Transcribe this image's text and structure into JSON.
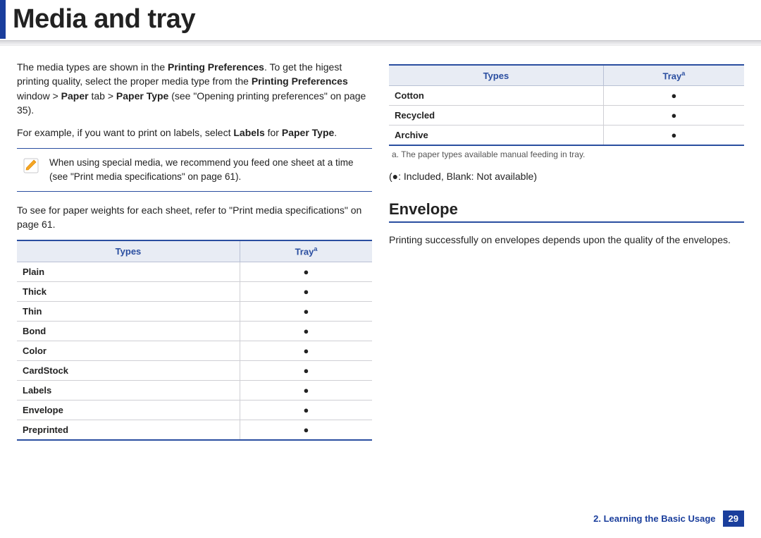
{
  "header": {
    "title": "Media and tray"
  },
  "left": {
    "p1_a": "The media types are shown in the ",
    "p1_b": "Printing Preferences",
    "p1_c": ". To get the higest printing quality, select the proper media type from the ",
    "p1_d": "Printing Preferences",
    "p1_e": " window > ",
    "p1_f": "Paper",
    "p1_g": " tab > ",
    "p1_h": "Paper Type",
    "p1_i": " (see \"Opening printing preferences\" on page 35).",
    "p2_a": "For example, if you want to print on labels, select ",
    "p2_b": "Labels",
    "p2_c": " for ",
    "p2_d": "Paper Type",
    "p2_e": ".",
    "note": "When using special media, we recommend you feed one sheet at a time (see \"Print media specifications\" on page 61).",
    "p3": "To see for paper weights for each sheet, refer to \"Print media specifications\" on page 61.",
    "table": {
      "head_types": "Types",
      "head_tray": "Tray",
      "head_tray_sup": "a",
      "rows": [
        {
          "type": "Plain",
          "mark": "●"
        },
        {
          "type": "Thick",
          "mark": "●"
        },
        {
          "type": "Thin",
          "mark": "●"
        },
        {
          "type": "Bond",
          "mark": "●"
        },
        {
          "type": "Color",
          "mark": "●"
        },
        {
          "type": "CardStock",
          "mark": "●"
        },
        {
          "type": "Labels",
          "mark": "●"
        },
        {
          "type": "Envelope",
          "mark": "●"
        },
        {
          "type": "Preprinted",
          "mark": "●"
        }
      ]
    }
  },
  "right": {
    "table": {
      "head_types": "Types",
      "head_tray": "Tray",
      "head_tray_sup": "a",
      "rows": [
        {
          "type": "Cotton",
          "mark": "●"
        },
        {
          "type": "Recycled",
          "mark": "●"
        },
        {
          "type": "Archive",
          "mark": "●"
        }
      ]
    },
    "footnote": "a. The paper types available manual feeding in tray.",
    "legend": "(●: Included, Blank: Not available)",
    "section_heading": "Envelope",
    "p1": "Printing successfully on envelopes depends upon the quality of the envelopes."
  },
  "footer": {
    "chapter": "2. Learning the Basic Usage",
    "page": "29"
  }
}
